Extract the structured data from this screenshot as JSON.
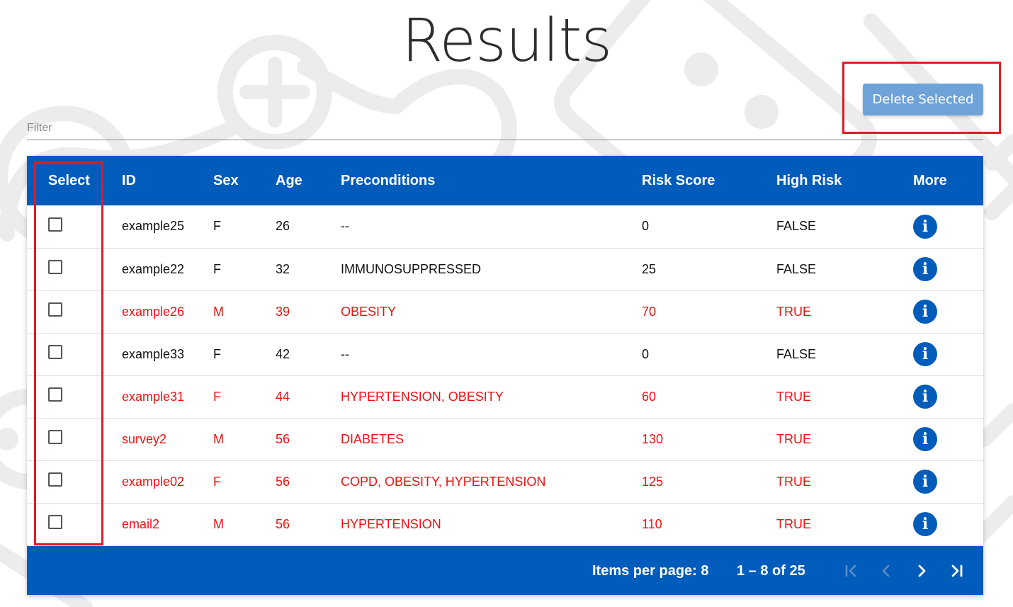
{
  "page": {
    "title": "Results"
  },
  "toolbar": {
    "delete_label": "Delete Selected"
  },
  "filter": {
    "placeholder": "Filter"
  },
  "table": {
    "columns": [
      "Select",
      "ID",
      "Sex",
      "Age",
      "Preconditions",
      "Risk Score",
      "High Risk",
      "More"
    ],
    "rows": [
      {
        "id": "example25",
        "sex": "F",
        "age": "26",
        "preconditions": "--",
        "risk_score": "0",
        "high_risk": "FALSE"
      },
      {
        "id": "example22",
        "sex": "F",
        "age": "32",
        "preconditions": "IMMUNOSUPPRESSED",
        "risk_score": "25",
        "high_risk": "FALSE"
      },
      {
        "id": "example26",
        "sex": "M",
        "age": "39",
        "preconditions": "OBESITY",
        "risk_score": "70",
        "high_risk": "TRUE"
      },
      {
        "id": "example33",
        "sex": "F",
        "age": "42",
        "preconditions": "--",
        "risk_score": "0",
        "high_risk": "FALSE"
      },
      {
        "id": "example31",
        "sex": "F",
        "age": "44",
        "preconditions": "HYPERTENSION, OBESITY",
        "risk_score": "60",
        "high_risk": "TRUE"
      },
      {
        "id": "survey2",
        "sex": "M",
        "age": "56",
        "preconditions": "DIABETES",
        "risk_score": "130",
        "high_risk": "TRUE"
      },
      {
        "id": "example02",
        "sex": "F",
        "age": "56",
        "preconditions": "COPD, OBESITY, HYPERTENSION",
        "risk_score": "125",
        "high_risk": "TRUE"
      },
      {
        "id": "email2",
        "sex": "M",
        "age": "56",
        "preconditions": "HYPERTENSION",
        "risk_score": "110",
        "high_risk": "TRUE"
      }
    ]
  },
  "paginator": {
    "items_per_page": "Items per page: 8",
    "range": "1 – 8 of 25"
  },
  "icons": {
    "info": "info-icon",
    "first_page": "first-page-icon",
    "prev_page": "chevron-left-icon",
    "next_page": "chevron-right-icon",
    "last_page": "last-page-icon"
  },
  "colors": {
    "primary": "#005cba",
    "button": "#6fa2d8",
    "high_risk_text": "#ee1111",
    "highlight": "#e01b24"
  }
}
